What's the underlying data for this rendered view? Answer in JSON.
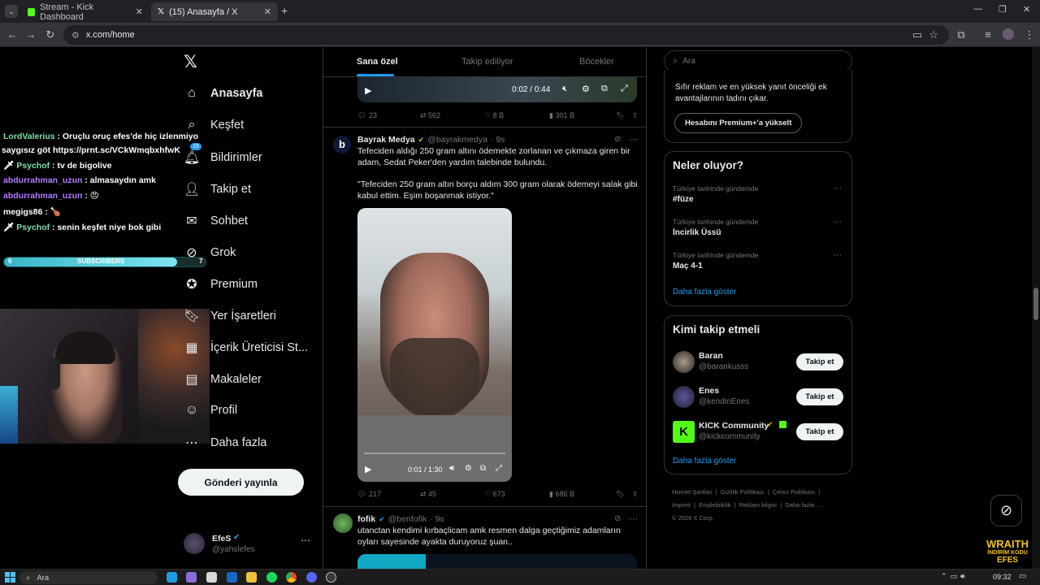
{
  "browser": {
    "tabs": [
      {
        "title": "Stream - Kick Dashboard",
        "active": false
      },
      {
        "title": "(15) Anasayfa / X",
        "active": true
      }
    ],
    "url": "x.com/home"
  },
  "overlay": {
    "chat": [
      {
        "user": "LordValerius",
        "msg": ": Oruçlu oruç efes'de hiç izlenmiyo"
      },
      {
        "user": "",
        "msg": "saygısız göt https://prnt.sc/VCkWmqbxhfwK"
      },
      {
        "user": "Psychof",
        "msg": ": tv de bigolive"
      },
      {
        "user": "abdurrahman_uzun",
        "msg": ": almasaydın amk"
      },
      {
        "user": "abdurrahman_uzun",
        "msg": ":"
      },
      {
        "user": "megigs86",
        "msg": ":"
      },
      {
        "user": "Psychof",
        "msg": ": senin keşfet niye bok gibi"
      }
    ],
    "subs": {
      "label": "SUBSCRIBERS",
      "current": "6",
      "goal": "7",
      "progress": 0.86
    },
    "promo": [
      "WRAITH",
      "İNDİRİM KODU",
      "EFES"
    ]
  },
  "nav": {
    "items": [
      {
        "label": "Anasayfa",
        "icon": "home-icon"
      },
      {
        "label": "Keşfet",
        "icon": "search-icon"
      },
      {
        "label": "Bildirimler",
        "icon": "bell-icon",
        "badge": "15"
      },
      {
        "label": "Takip et",
        "icon": "follow-icon"
      },
      {
        "label": "Sohbet",
        "icon": "mail-icon"
      },
      {
        "label": "Grok",
        "icon": "grok-icon"
      },
      {
        "label": "Premium",
        "icon": "premium-icon"
      },
      {
        "label": "Yer İşaretleri",
        "icon": "bookmark-icon"
      },
      {
        "label": "İçerik Üreticisi St...",
        "icon": "creator-icon"
      },
      {
        "label": "Makaleler",
        "icon": "article-icon"
      },
      {
        "label": "Profil",
        "icon": "profile-icon"
      },
      {
        "label": "Daha fazla",
        "icon": "more-icon"
      }
    ],
    "post_button": "Gönderi yayınla",
    "account": {
      "name": "EfeS",
      "handle": "@yahslefes"
    }
  },
  "timeline": {
    "tabs": [
      "Sana özel",
      "Takip ediliyor",
      "Böcekler"
    ],
    "top_video": {
      "time": "0:02 / 0:44"
    },
    "top_actions": {
      "replies": "23",
      "reposts": "562",
      "likes": "8 B",
      "views": "301 B"
    },
    "tweet1": {
      "name": "Bayrak Medya",
      "handle": "@bayrakmedya",
      "time": "· 9s",
      "text1": "Tefeciden aldığı 250 gram altını ödemekte zorlanan ve çıkmaza giren bir adam, Sedat Peker'den yardım talebinde bulundu.",
      "text2": "\"Tefeciden 250 gram altın borçu aldım 300 gram olarak ödemeyi salak gibi kabul ettim. Eşim boşanmak istiyor.\"",
      "video_time": "0:01 / 1:30",
      "video_progress": 0.01,
      "actions": {
        "replies": "217",
        "reposts": "45",
        "likes": "673",
        "views": "686 B"
      }
    },
    "tweet2": {
      "name": "fofik",
      "handle": "@benfofik",
      "time": "· 9s",
      "text": "utanctan kendimi kırbaçlicam amk resmen dalga geçtiğimiz adamların oyları sayesinde ayakta duruyoruz şuan.."
    }
  },
  "sidebar": {
    "search_placeholder": "Ara",
    "premium": {
      "text": "Sıfır reklam ve en yüksek yanıt önceliği ek avantajlarının tadını çıkar.",
      "button": "Hesabını Premium+'a yükselt"
    },
    "trends": {
      "title": "Neler oluyor?",
      "items": [
        {
          "meta": "Türkiye tarihinde gündemde",
          "name": "#füze"
        },
        {
          "meta": "Türkiye tarihinde gündemde",
          "name": "İncirlik Üssü"
        },
        {
          "meta": "Türkiye tarihinde gündemde",
          "name": "Maç 4-1"
        }
      ],
      "more": "Daha fazla göster"
    },
    "who_to_follow": {
      "title": "Kimi takip etmeli",
      "items": [
        {
          "name": "Baran",
          "handle": "@barankusss",
          "button": "Takip et"
        },
        {
          "name": "Enes",
          "handle": "@kendinEnes",
          "button": "Takip et"
        },
        {
          "name": "KICK Community",
          "handle": "@kickcommunity",
          "button": "Takip et"
        }
      ],
      "more": "Daha fazla göster"
    },
    "footer": [
      "Hizmet Şartları",
      "Gizlilik Politikası",
      "Çerez Politikası",
      "Imprint",
      "Erişilebilirlik",
      "Reklam bilgisi",
      "Daha fazla ...",
      "© 2026 X Corp."
    ]
  },
  "taskbar": {
    "search": "Ara",
    "clock": "09:32"
  },
  "colors": {
    "accent": "#1d9bf0",
    "kick": "#53fc18",
    "bg": "#000000"
  }
}
